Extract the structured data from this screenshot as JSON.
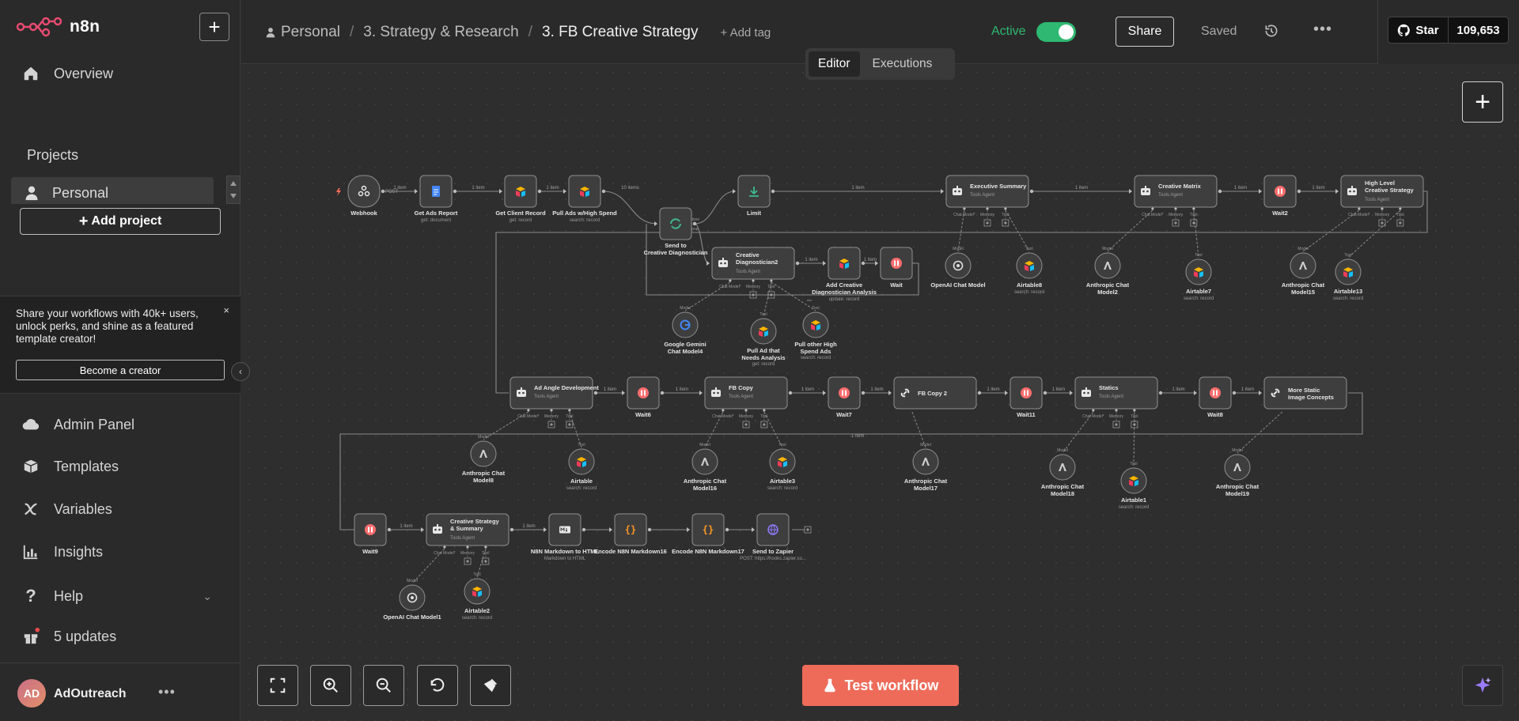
{
  "app": {
    "brand": "n8n",
    "accent": "#ee6b5a",
    "active_color": "#2eb872"
  },
  "sidebar": {
    "overview": "Overview",
    "projects_title": "Projects",
    "personal": "Personal",
    "add_project": "Add project",
    "promo_text": "Share your workflows with 40k+ users, unlock perks, and shine as a featured template creator!",
    "promo_close": "×",
    "become_creator": "Become a creator",
    "admin_panel": "Admin Panel",
    "templates": "Templates",
    "variables": "Variables",
    "insights": "Insights",
    "help": "Help",
    "updates": "5 updates",
    "user": {
      "initials": "AD",
      "name": "AdOutreach"
    }
  },
  "header": {
    "crumbs": [
      "Personal",
      "3. Strategy & Research",
      "3. FB Creative Strategy"
    ],
    "add_tag": "+ Add tag",
    "active_label": "Active",
    "active": true,
    "share": "Share",
    "saved": "Saved",
    "github": {
      "star": "Star",
      "count": "109,653"
    },
    "tabs": [
      "Editor",
      "Executions"
    ]
  },
  "footer": {
    "test_workflow": "Test workflow"
  },
  "workflow": {
    "nodes": [
      {
        "id": "webhook",
        "label": "Webhook",
        "sub": "",
        "icon": "webhook-icon"
      },
      {
        "id": "get_ads",
        "label": "Get Ads Report",
        "sub": "get: document",
        "icon": "google-docs-icon"
      },
      {
        "id": "get_client",
        "label": "Get Client Record",
        "sub": "get: record",
        "icon": "airtable-icon"
      },
      {
        "id": "pull_ads",
        "label": "Pull Ads w/High Spend",
        "sub": "search: record",
        "icon": "airtable-icon"
      },
      {
        "id": "send_diag",
        "label": "Send to Creative Diagnostician",
        "sub": "",
        "icon": "loop-icon"
      },
      {
        "id": "limit",
        "label": "Limit",
        "sub": "",
        "icon": "limit-icon"
      },
      {
        "id": "exec_summary",
        "label": "Executive Summary",
        "sub": "Tools Agent",
        "icon": "robot-icon"
      },
      {
        "id": "creative_matrix",
        "label": "Creative Matrix",
        "sub": "Tools Agent",
        "icon": "robot-icon"
      },
      {
        "id": "wait2",
        "label": "Wait2",
        "sub": "",
        "icon": "pause-icon"
      },
      {
        "id": "hl_strategy",
        "label": "High Level Creative Strategy",
        "sub": "Tools Agent",
        "icon": "robot-icon"
      },
      {
        "id": "diag2",
        "label": "Creative Diagnostician2",
        "sub": "Tools Agent",
        "icon": "robot-icon"
      },
      {
        "id": "add_analysis",
        "label": "Add Creative Diagnostician Analysis",
        "sub": "update: record",
        "icon": "airtable-icon"
      },
      {
        "id": "wait",
        "label": "Wait",
        "sub": "",
        "icon": "pause-icon"
      },
      {
        "id": "openai1",
        "label": "OpenAI Chat Model",
        "sub": "",
        "icon": "openai-icon"
      },
      {
        "id": "airtable8",
        "label": "Airtable8",
        "sub": "search: record",
        "icon": "airtable-icon"
      },
      {
        "id": "anthropic2",
        "label": "Anthropic Chat Model2",
        "sub": "",
        "icon": "anthropic-icon"
      },
      {
        "id": "airtable7",
        "label": "Airtable7",
        "sub": "search: record",
        "icon": "airtable-icon"
      },
      {
        "id": "anthropic15",
        "label": "Anthropic Chat Model15",
        "sub": "",
        "icon": "anthropic-icon"
      },
      {
        "id": "airtable13",
        "label": "Airtable13",
        "sub": "search: record",
        "icon": "airtable-icon"
      },
      {
        "id": "gemini4",
        "label": "Google Gemini Chat Model4",
        "sub": "",
        "icon": "google-icon"
      },
      {
        "id": "pull_needs",
        "label": "Pull Ad that Needs Analysis",
        "sub": "get: record",
        "icon": "airtable-icon"
      },
      {
        "id": "pull_other",
        "label": "Pull other High Spend Ads",
        "sub": "search: record",
        "icon": "airtable-icon"
      },
      {
        "id": "ad_angle",
        "label": "Ad Angle Development",
        "sub": "Tools Agent",
        "icon": "robot-icon"
      },
      {
        "id": "wait6",
        "label": "Wait6",
        "sub": "",
        "icon": "pause-icon"
      },
      {
        "id": "fb_copy",
        "label": "FB Copy",
        "sub": "Tools Agent",
        "icon": "robot-icon"
      },
      {
        "id": "wait7",
        "label": "Wait7",
        "sub": "",
        "icon": "pause-icon"
      },
      {
        "id": "fb_copy2",
        "label": "FB Copy 2",
        "sub": "",
        "icon": "link-icon"
      },
      {
        "id": "wait11",
        "label": "Wait11",
        "sub": "",
        "icon": "pause-icon"
      },
      {
        "id": "statics",
        "label": "Statics",
        "sub": "Tools Agent",
        "icon": "robot-icon"
      },
      {
        "id": "wait8",
        "label": "Wait8",
        "sub": "",
        "icon": "pause-icon"
      },
      {
        "id": "more_static",
        "label": "More Static Image Concepts",
        "sub": "",
        "icon": "link-icon"
      },
      {
        "id": "anthropic8",
        "label": "Anthropic Chat Model8",
        "sub": "",
        "icon": "anthropic-icon"
      },
      {
        "id": "airtable",
        "label": "Airtable",
        "sub": "search: record",
        "icon": "airtable-icon"
      },
      {
        "id": "anthropic16",
        "label": "Anthropic Chat Model16",
        "sub": "",
        "icon": "anthropic-icon"
      },
      {
        "id": "airtable3",
        "label": "Airtable3",
        "sub": "search: record",
        "icon": "airtable-icon"
      },
      {
        "id": "anthropic17",
        "label": "Anthropic Chat Model17",
        "sub": "",
        "icon": "anthropic-icon"
      },
      {
        "id": "anthropic18",
        "label": "Anthropic Chat Model18",
        "sub": "",
        "icon": "anthropic-icon"
      },
      {
        "id": "airtable1",
        "label": "Airtable1",
        "sub": "search: record",
        "icon": "airtable-icon"
      },
      {
        "id": "anthropic19",
        "label": "Anthropic Chat Model19",
        "sub": "",
        "icon": "anthropic-icon"
      },
      {
        "id": "wait9",
        "label": "Wait9",
        "sub": "",
        "icon": "pause-icon"
      },
      {
        "id": "cs_summary",
        "label": "Creative Strategy & Summary",
        "sub": "Tools Agent",
        "icon": "robot-icon"
      },
      {
        "id": "md_html",
        "label": "N8N Markdown to HTML",
        "sub": "Markdown to HTML",
        "icon": "markdown-icon"
      },
      {
        "id": "enc16",
        "label": "Encode N8N Markdown16",
        "sub": "",
        "icon": "code-icon"
      },
      {
        "id": "enc17",
        "label": "Encode N8N Markdown17",
        "sub": "",
        "icon": "code-icon"
      },
      {
        "id": "zapier",
        "label": "Send to Zapier",
        "sub": "POST: https://hooks.zapier.co...",
        "icon": "globe-icon"
      },
      {
        "id": "openai11",
        "label": "OpenAI Chat Model1",
        "sub": "",
        "icon": "openai-icon"
      },
      {
        "id": "airtable2",
        "label": "Airtable2",
        "sub": "search: record",
        "icon": "airtable-icon"
      }
    ],
    "edge_labels": {
      "one_item": "1 item",
      "ten_items": "10 items",
      "done": "done",
      "loop": "loop",
      "post": "POST"
    },
    "port_labels": {
      "chat_model": "Chat Model*",
      "memory": "Memory",
      "tool": "Tool",
      "model": "Model"
    }
  }
}
